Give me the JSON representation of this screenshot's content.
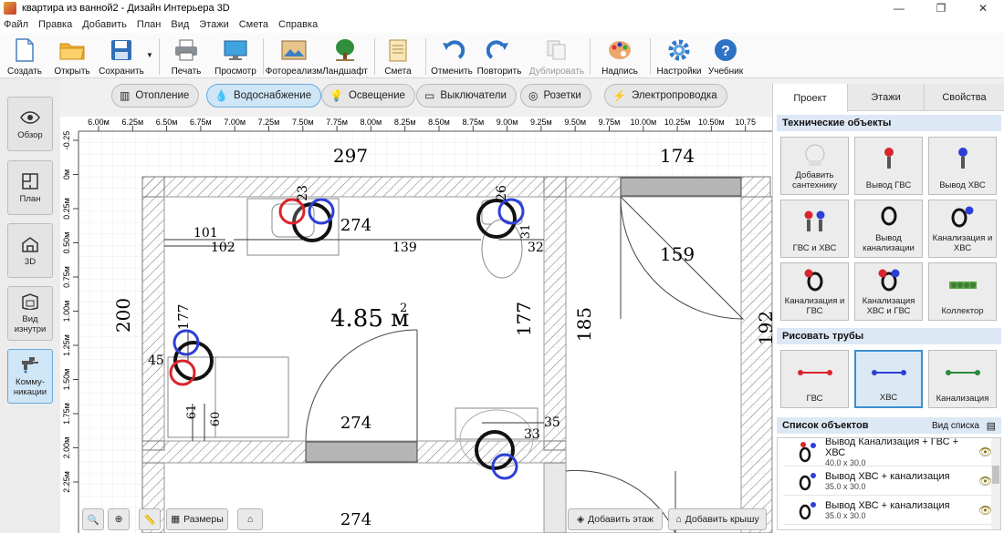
{
  "window": {
    "title": "квартира из ванной2 - Дизайн Интерьера 3D",
    "min": "—",
    "max": "❐",
    "close": "✕"
  },
  "menu": [
    "Файл",
    "Правка",
    "Добавить",
    "План",
    "Вид",
    "Этажи",
    "Смета",
    "Справка"
  ],
  "toolbar": {
    "create": "Создать",
    "open": "Открыть",
    "save": "Сохранить",
    "print": "Печать",
    "preview": "Просмотр",
    "photoreal": "Фотореализм",
    "landscape": "Ландшафт",
    "estimate": "Смета",
    "undo": "Отменить",
    "redo": "Повторить",
    "duplicate": "Дублировать",
    "caption": "Надпись",
    "settings": "Настройки",
    "tutorial": "Учебник"
  },
  "left": {
    "overview": "Обзор",
    "plan": "План",
    "three_d": "3D",
    "inside": "Вид изнутри",
    "comm": "Комму-никации"
  },
  "categories": {
    "heating": "Отопление",
    "water": "Водоснабжение",
    "light": "Освещение",
    "switches": "Выключатели",
    "sockets": "Розетки",
    "wiring": "Электропроводка"
  },
  "ruler": {
    "top": [
      "6.00м",
      "6.25м",
      "6.50м",
      "6.75м",
      "7.00м",
      "7.25м",
      "7.50м",
      "7.75м",
      "8.00м",
      "8.25м",
      "8.50м",
      "8.75м",
      "9.00м",
      "9.25м",
      "9.50м",
      "9.75м",
      "10.00м",
      "10.25м",
      "10.50м",
      "10.75"
    ],
    "left": [
      "-0.25",
      "0м",
      "0.25м",
      "0.50м",
      "0.75м",
      "1.00м",
      "1.25м",
      "1.50м",
      "1.75м",
      "2.00м",
      "2.25м"
    ]
  },
  "plan": {
    "dims": {
      "d297": "297",
      "d174": "174",
      "d159": "159",
      "d200": "200",
      "d185": "185",
      "d177r": "177",
      "d192": "192",
      "d274a": "274",
      "d274b": "274",
      "d274c": "274",
      "d23": "23",
      "d26": "26",
      "d101": "101",
      "d102": "102",
      "d139": "139",
      "d31": "31",
      "d32": "32",
      "d177l": "177",
      "d45": "45",
      "d61": "61",
      "d60": "60",
      "d33": "33",
      "d35": "35"
    },
    "area": "4.85 м",
    "area_sup": "2"
  },
  "canvas_buttons": {
    "sizes": "Размеры",
    "add_floor": "Добавить этаж",
    "add_roof": "Добавить крышу"
  },
  "panel": {
    "tabs": [
      "Проект",
      "Этажи",
      "Свойства"
    ],
    "tech_header": "Технические объекты",
    "tech": [
      "Добавить сантехнику",
      "Вывод ГВС",
      "Вывод ХВС",
      "ГВС и ХВС",
      "Вывод канализации",
      "Канализация и ХВС",
      "Канализация и ГВС",
      "Канализация ХВС и ГВС",
      "Коллектор"
    ],
    "pipes_header": "Рисовать трубы",
    "pipes": [
      "ГВС",
      "ХВС",
      "Канализация"
    ],
    "list_header": "Список объектов",
    "list_view": "Вид списка",
    "objects": [
      {
        "name": "Вывод Канализация + ГВС + ХВС",
        "dim": "40.0 x 30.0"
      },
      {
        "name": "Вывод ХВС + канализация",
        "dim": "35.0 x 30.0"
      },
      {
        "name": "Вывод ХВС + канализация",
        "dim": "35.0 x 30.0"
      }
    ]
  },
  "colors": {
    "hot": "#d9252b",
    "cold": "#2d3fd6",
    "drain": "#2a8a3a",
    "accent": "#3b8fd0"
  }
}
